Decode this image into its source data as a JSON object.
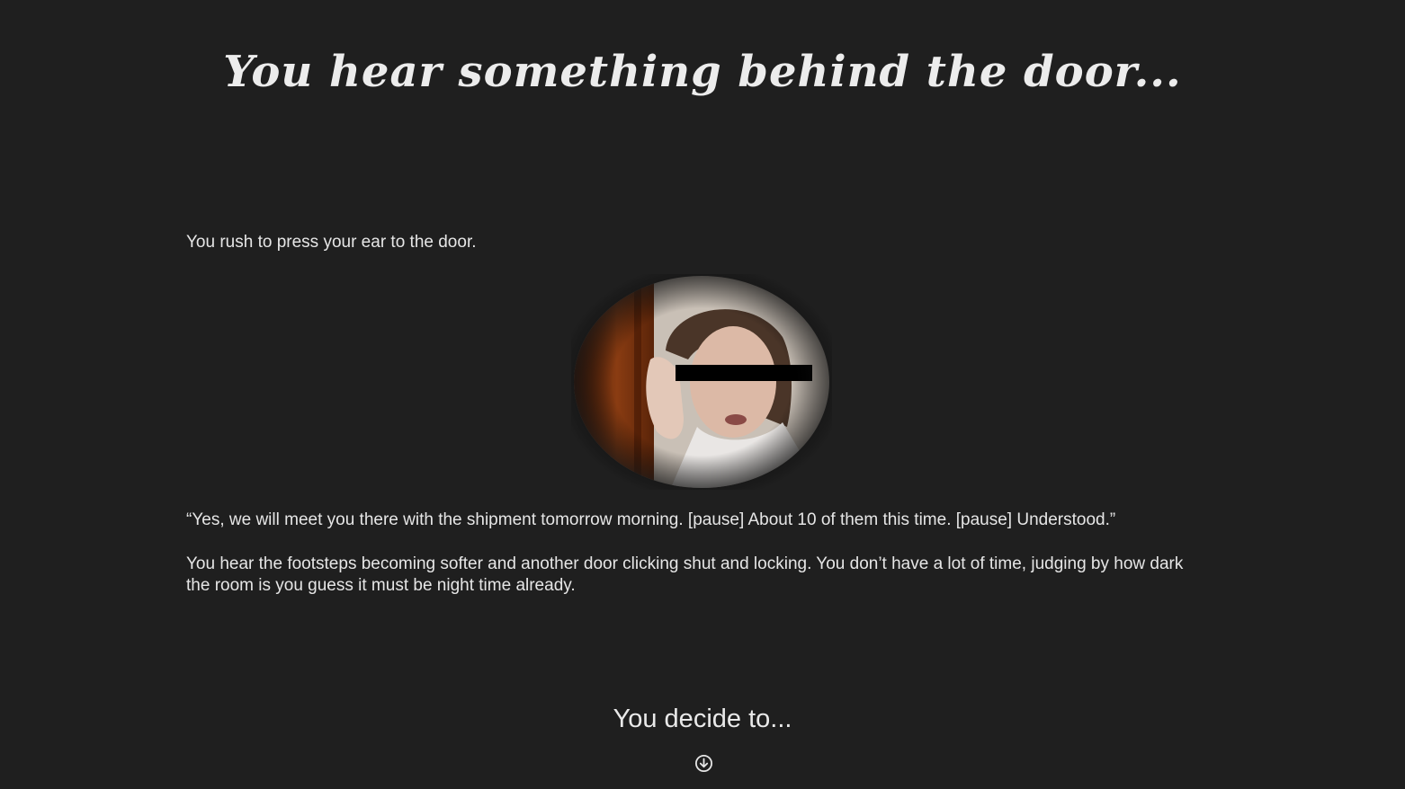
{
  "page": {
    "title": "You hear something behind the door...",
    "paragraphs": {
      "intro": "You rush to press your ear to the door.",
      "quote": "“Yes, we will meet you there with the shipment tomorrow morning. [pause] About 10 of them this time. [pause] Understood.”",
      "footsteps": "You hear the footsteps becoming softer and another door clicking shut and locking. You don’t have a lot of time, judging by how dark the room is you guess it must be night time already."
    },
    "image": {
      "icon": "woman-listening-at-door-illustration"
    },
    "prompt": "You decide to...",
    "scroll": {
      "icon": "arrow-down-circle-icon"
    }
  },
  "colors": {
    "background": "#1f1f1f",
    "text": "#e3e3e3"
  }
}
